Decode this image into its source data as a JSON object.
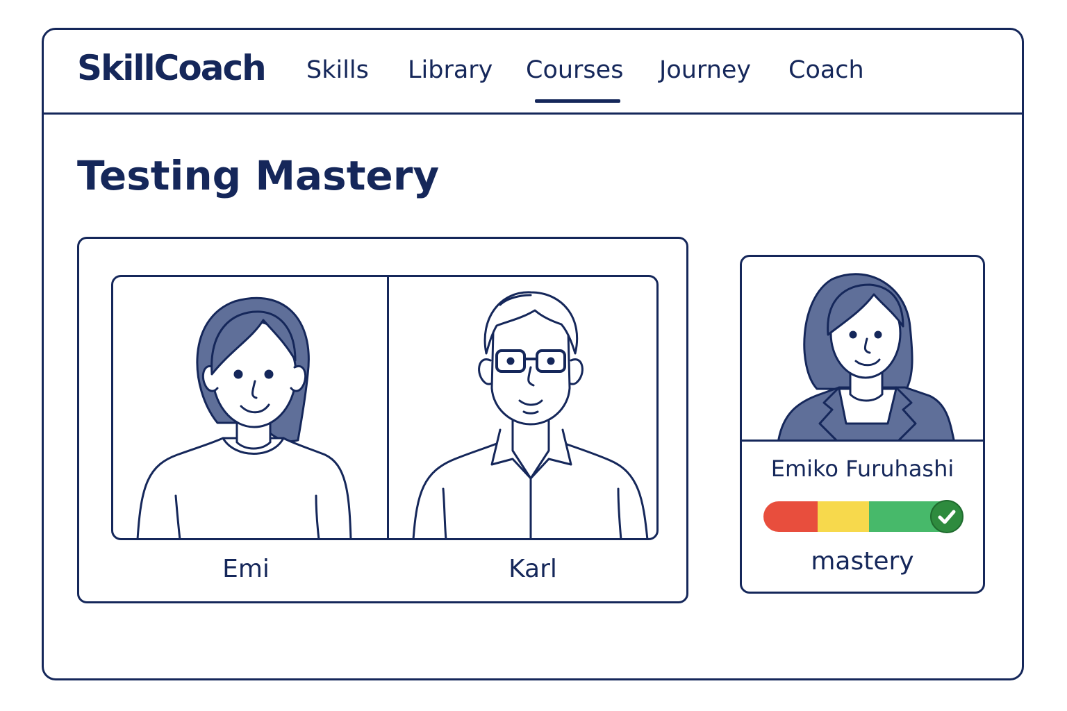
{
  "app": {
    "brand": "SkillCoach"
  },
  "nav": {
    "items": [
      {
        "label": "Skills"
      },
      {
        "label": "Library"
      },
      {
        "label": "Courses",
        "active": true
      },
      {
        "label": "Journey"
      },
      {
        "label": "Coach"
      }
    ]
  },
  "page": {
    "title": "Testing Mastery"
  },
  "session": {
    "participants": [
      {
        "name": "Emi",
        "icon": "woman-avatar-icon"
      },
      {
        "name": "Karl",
        "icon": "man-with-glasses-avatar-icon"
      }
    ]
  },
  "profile": {
    "name": "Emiko Furuhashi",
    "icon": "woman-in-blazer-avatar-icon",
    "meter": {
      "segments": [
        {
          "color": "#e84e3d"
        },
        {
          "color": "#f7d94c"
        },
        {
          "color": "#47b96a"
        }
      ],
      "level": "complete",
      "badge_icon": "check-icon"
    },
    "status": "mastery"
  },
  "colors": {
    "primary": "#15275a",
    "hair": "#5f6f99",
    "badge": "#2e8b3e"
  }
}
